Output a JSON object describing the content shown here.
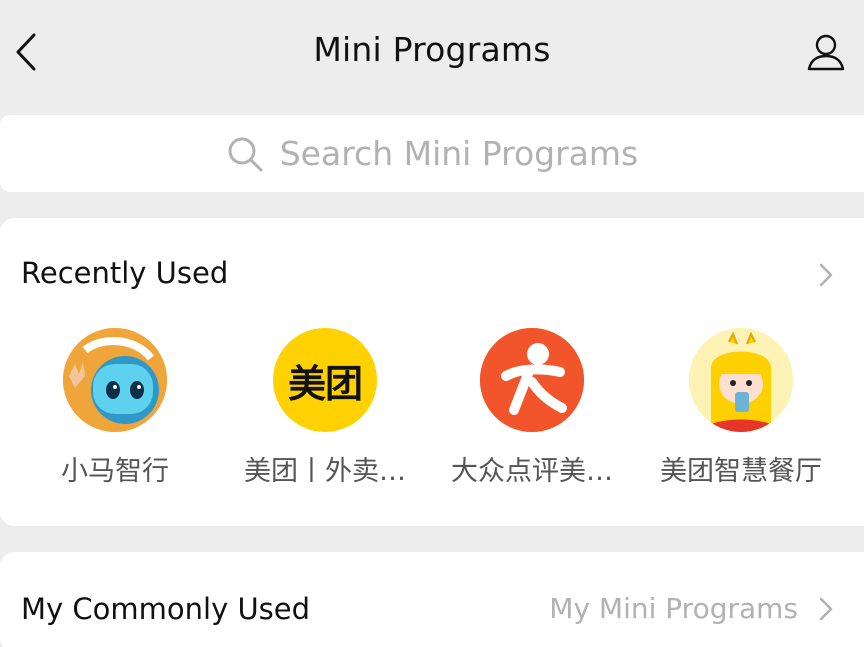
{
  "navbar": {
    "title": "Mini Programs",
    "back_icon": "chevron-left-icon",
    "profile_icon": "person-icon"
  },
  "search": {
    "placeholder": "Search Mini Programs",
    "icon": "search-icon"
  },
  "recent": {
    "title": "Recently Used",
    "apps": [
      {
        "label": "小马智行",
        "icon": "robot-mascot-icon",
        "color": "#f0a53a"
      },
      {
        "label": "美团丨外卖…",
        "icon_text": "美团",
        "icon": "meituan-logo-icon",
        "color": "#ffd100"
      },
      {
        "label": "大众点评美…",
        "icon": "dianping-logo-icon",
        "color": "#f2552c"
      },
      {
        "label": "美团智慧餐厅",
        "icon": "kid-mascot-icon",
        "color": "#ffd84a"
      }
    ]
  },
  "common": {
    "title": "My Commonly Used",
    "link": "My Mini Programs"
  }
}
